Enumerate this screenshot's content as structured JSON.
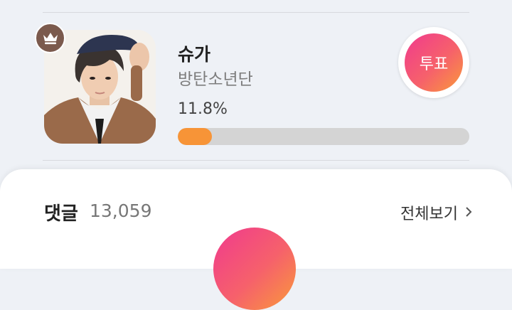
{
  "candidate": {
    "name": "슈가",
    "group": "방탄소년단",
    "percent_label": "11.8%",
    "progress_fraction": 0.118,
    "vote_label": "투표",
    "photo_icon": "person-photo",
    "badge_icon": "crown-icon"
  },
  "comments": {
    "title": "댓글",
    "count": "13,059",
    "view_all_label": "전체보기",
    "view_all_icon": "chevron-right-icon"
  },
  "colors": {
    "accent_gradient_start": "#f03a8e",
    "accent_gradient_end": "#f99a3a",
    "progress_fill": "#f79437",
    "badge": "#7b5a4d"
  }
}
